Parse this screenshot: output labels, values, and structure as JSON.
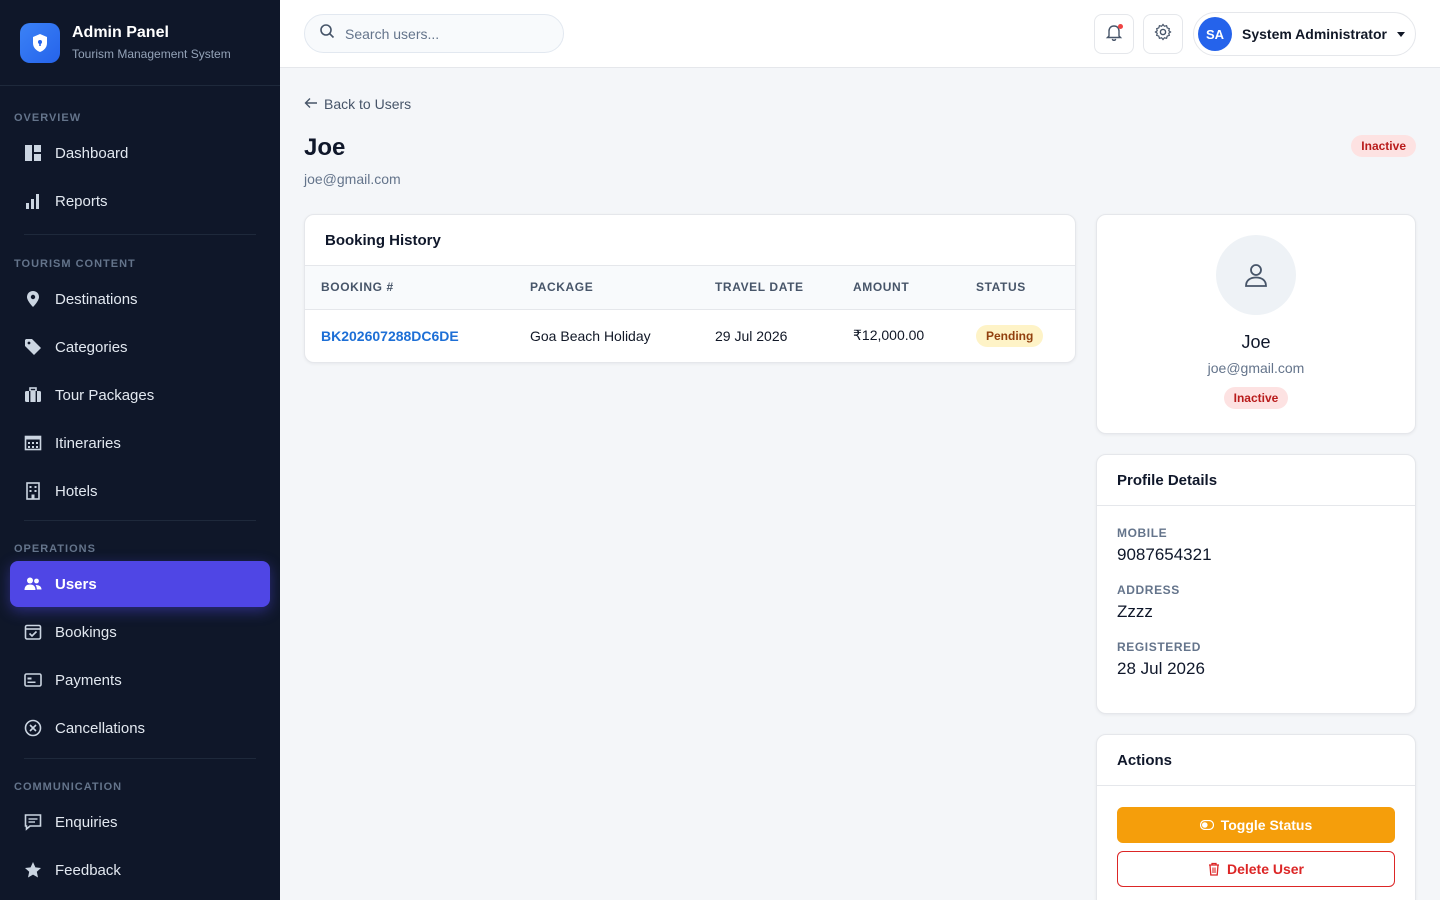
{
  "brand": {
    "title": "Admin Panel",
    "subtitle": "Tourism Management System"
  },
  "sidebar": {
    "sections": [
      {
        "label": "OVERVIEW",
        "items": [
          {
            "label": "Dashboard",
            "icon": "dashboard-icon"
          },
          {
            "label": "Reports",
            "icon": "bar-chart-icon"
          }
        ]
      },
      {
        "label": "TOURISM CONTENT",
        "items": [
          {
            "label": "Destinations",
            "icon": "map-pin-icon"
          },
          {
            "label": "Categories",
            "icon": "tag-icon"
          },
          {
            "label": "Tour Packages",
            "icon": "suitcase-icon"
          },
          {
            "label": "Itineraries",
            "icon": "calendar-grid-icon"
          },
          {
            "label": "Hotels",
            "icon": "building-icon"
          }
        ]
      },
      {
        "label": "OPERATIONS",
        "items": [
          {
            "label": "Users",
            "icon": "users-icon",
            "active": true
          },
          {
            "label": "Bookings",
            "icon": "calendar-check-icon"
          },
          {
            "label": "Payments",
            "icon": "credit-card-icon"
          },
          {
            "label": "Cancellations",
            "icon": "x-circle-icon"
          }
        ]
      },
      {
        "label": "COMMUNICATION",
        "items": [
          {
            "label": "Enquiries",
            "icon": "message-icon"
          },
          {
            "label": "Feedback",
            "icon": "star-icon"
          }
        ]
      }
    ]
  },
  "topbar": {
    "search_placeholder": "Search users...",
    "user": {
      "initials": "SA",
      "name": "System Administrator"
    }
  },
  "page": {
    "back_label": "Back to Users",
    "title": "Joe",
    "email": "joe@gmail.com",
    "status": "Inactive"
  },
  "booking_history": {
    "title": "Booking History",
    "columns": [
      "BOOKING #",
      "PACKAGE",
      "TRAVEL DATE",
      "AMOUNT",
      "STATUS"
    ],
    "rows": [
      {
        "booking": "BK202607288DC6DE",
        "package": "Goa Beach Holiday",
        "date": "29 Jul 2026",
        "amount": "₹12,000.00",
        "status": "Pending"
      }
    ]
  },
  "profile": {
    "name": "Joe",
    "email": "joe@gmail.com",
    "status": "Inactive"
  },
  "details": {
    "title": "Profile Details",
    "fields": [
      {
        "label": "MOBILE",
        "value": "9087654321"
      },
      {
        "label": "ADDRESS",
        "value": "Zzzz"
      },
      {
        "label": "REGISTERED",
        "value": "28 Jul 2026"
      }
    ]
  },
  "actions": {
    "title": "Actions",
    "toggle_label": "Toggle Status",
    "delete_label": "Delete User"
  },
  "colors": {
    "sidebar_bg": "#0f1729",
    "accent": "#4f46e5",
    "link": "#1d6fd6",
    "warning": "#f59e0b",
    "danger": "#dc2626"
  }
}
